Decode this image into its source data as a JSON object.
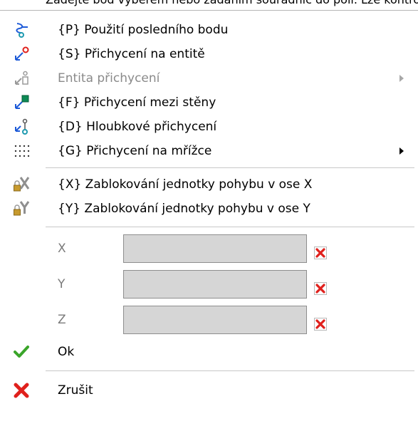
{
  "top_text": "Zadejte bod výběrem nebo zadáním souřadnic do polí. Lze kontrolovat hodnotu souřadnic v polích a potvrzením volbou pokaždé Ctrl",
  "menu": {
    "items": [
      {
        "label": "{P} Použití posledního bodu",
        "icon": "last-point-icon",
        "disabled": false
      },
      {
        "label": "{S} Přichycení na entitě",
        "icon": "snap-entity-icon",
        "disabled": false
      },
      {
        "label": "Entita přichycení",
        "icon": "snap-entity-type-icon",
        "disabled": true,
        "submenu": true
      },
      {
        "label": "{F} Přichycení mezi stěny",
        "icon": "snap-between-walls-icon",
        "disabled": false
      },
      {
        "label": "{D} Hloubkové přichycení",
        "icon": "depth-snap-icon",
        "disabled": false
      },
      {
        "label": "{G} Přichycení na mřížce",
        "icon": "grid-snap-icon",
        "disabled": false,
        "submenu": true
      }
    ],
    "lock_items": [
      {
        "label": "{X} Zablokování jednotky pohybu v ose X",
        "icon": "lock-x-icon"
      },
      {
        "label": "{Y} Zablokování jednotky pohybu v ose Y",
        "icon": "lock-y-icon"
      }
    ],
    "coords": [
      {
        "label": "X",
        "value": ""
      },
      {
        "label": "Y",
        "value": ""
      },
      {
        "label": "Z",
        "value": ""
      }
    ],
    "ok_label": "Ok",
    "cancel_label": "Zrušit"
  },
  "colors": {
    "accent_blue": "#1e5bd8",
    "accent_red": "#e0201c",
    "check_green": "#3aa52a",
    "separator": "#c8c8c8"
  }
}
